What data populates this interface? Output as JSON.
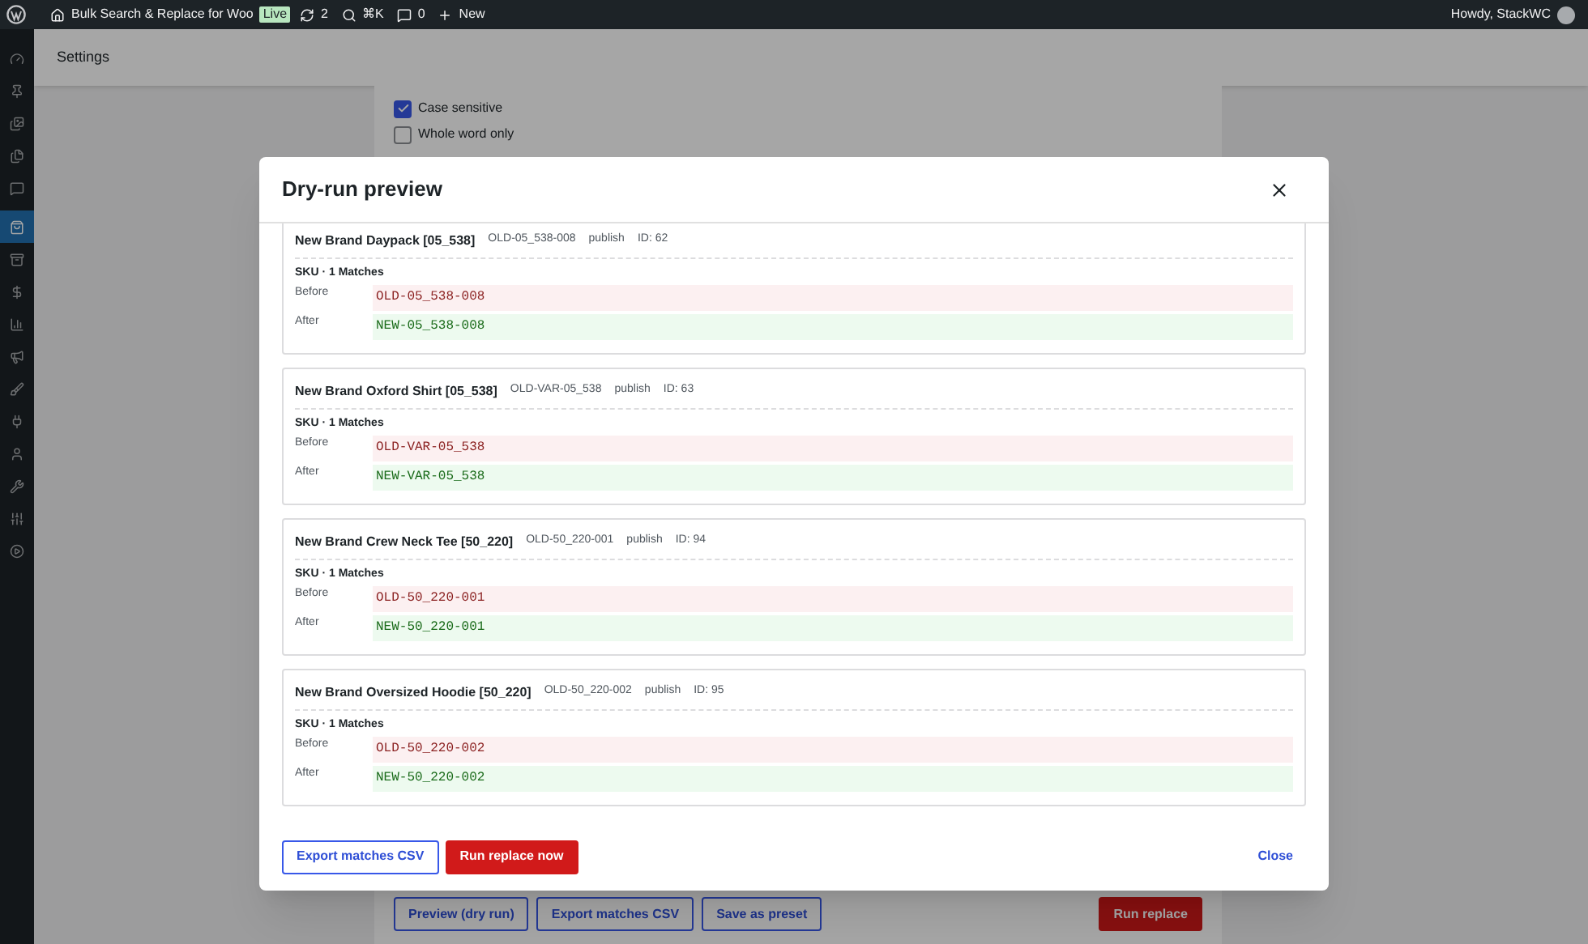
{
  "admin_bar": {
    "site_name": "Bulk Search & Replace for Woo",
    "env_badge": "Live",
    "updates": "2",
    "shortcut": "⌘K",
    "comments": "0",
    "new_label": "New",
    "greeting": "Howdy, StackWC"
  },
  "sidebar": {
    "items": [
      {
        "selected": false
      },
      {
        "selected": false
      },
      {
        "selected": false
      },
      {
        "selected": false
      },
      {
        "selected": false
      },
      {
        "selected": true
      },
      {
        "selected": false
      },
      {
        "selected": false
      },
      {
        "selected": false
      },
      {
        "selected": false
      },
      {
        "selected": false
      },
      {
        "selected": false
      },
      {
        "selected": false
      },
      {
        "selected": false
      },
      {
        "selected": false
      },
      {
        "selected": false
      }
    ]
  },
  "page_header": {
    "title": "Settings"
  },
  "options": [
    {
      "label": "Case sensitive",
      "checked": true
    },
    {
      "label": "Whole word only",
      "checked": false
    }
  ],
  "page_actions": [
    {
      "label": "Preview (dry run)",
      "kind": "outline"
    },
    {
      "label": "Export matches CSV",
      "kind": "outline"
    },
    {
      "label": "Save as preset",
      "kind": "outline"
    },
    {
      "label": "Run replace",
      "kind": "danger"
    }
  ],
  "modal": {
    "title": "Dry-run preview",
    "results": [
      {
        "name": "New Brand Daypack [05_538]",
        "sku": "OLD-05_538-008",
        "status": "publish",
        "id": "ID: 62",
        "field": "SKU · 1 Matches",
        "before_label": "Before",
        "before": "OLD-05_538-008",
        "after_label": "After",
        "after": "NEW-05_538-008"
      },
      {
        "name": "New Brand Oxford Shirt [05_538]",
        "sku": "OLD-VAR-05_538",
        "status": "publish",
        "id": "ID: 63",
        "field": "SKU · 1 Matches",
        "before_label": "Before",
        "before": "OLD-VAR-05_538",
        "after_label": "After",
        "after": "NEW-VAR-05_538"
      },
      {
        "name": "New Brand Crew Neck Tee [50_220]",
        "sku": "OLD-50_220-001",
        "status": "publish",
        "id": "ID: 94",
        "field": "SKU · 1 Matches",
        "before_label": "Before",
        "before": "OLD-50_220-001",
        "after_label": "After",
        "after": "NEW-50_220-001"
      },
      {
        "name": "New Brand Oversized Hoodie [50_220]",
        "sku": "OLD-50_220-002",
        "status": "publish",
        "id": "ID: 95",
        "field": "SKU · 1 Matches",
        "before_label": "Before",
        "before": "OLD-50_220-002",
        "after_label": "After",
        "after": "NEW-50_220-002"
      }
    ],
    "footer_buttons": [
      {
        "label": "Export matches CSV",
        "kind": "outline"
      },
      {
        "label": "Run replace now",
        "kind": "danger"
      },
      {
        "label": "Close",
        "kind": "link"
      }
    ]
  }
}
